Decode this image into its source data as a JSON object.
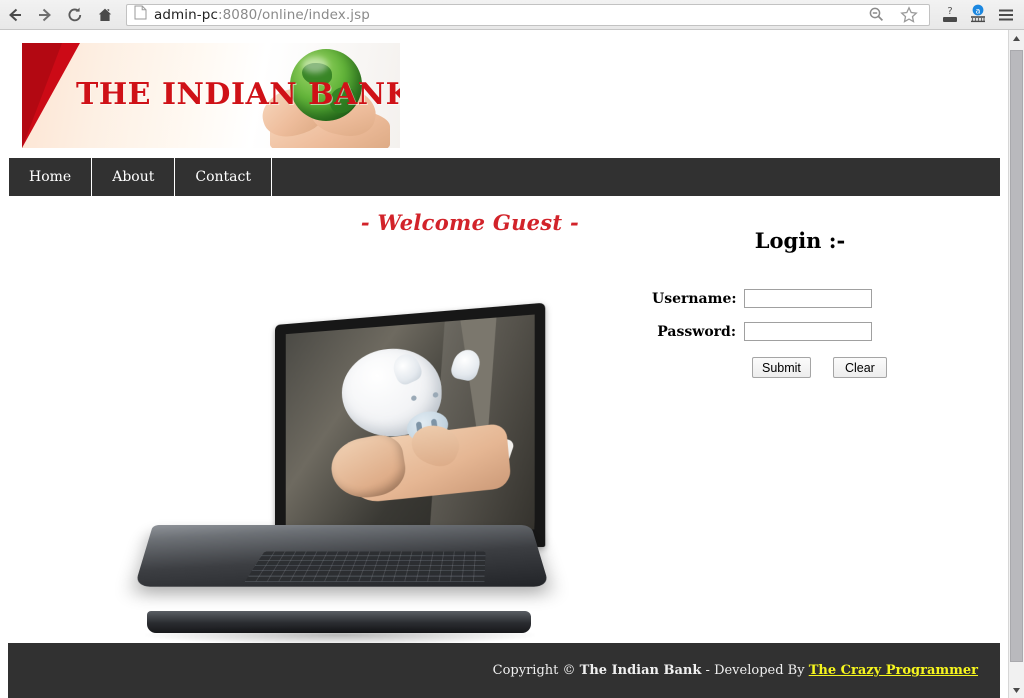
{
  "browser": {
    "back_label": "Back",
    "forward_label": "Forward",
    "reload_label": "Reload",
    "home_label": "Home",
    "url_host": "admin-pc",
    "url_rest": ":8080/online/index.jsp",
    "url_full": "admin-pc:8080/online/index.jsp",
    "icons": {
      "page": "page-icon",
      "back": "back-arrow-icon",
      "forward": "forward-arrow-icon",
      "reload": "reload-icon",
      "home": "home-icon",
      "zoom_out": "zoom-out-icon",
      "bookmark": "star-icon",
      "extension_help": "question-mark-extension-icon",
      "extension_adblock": "adblock-extension-icon",
      "menu": "hamburger-menu-icon"
    }
  },
  "banner": {
    "title": "THE INDIAN BANK",
    "art_name": "hands-holding-green-globe"
  },
  "nav": {
    "items": [
      {
        "label": "Home"
      },
      {
        "label": "About"
      },
      {
        "label": "Contact"
      }
    ]
  },
  "content": {
    "welcome": "- Welcome Guest -",
    "hero_alt": "laptop-with-hand-holding-piggy-bank"
  },
  "login": {
    "heading": "Login :-",
    "username_label": "Username:",
    "username_value": "",
    "username_placeholder": "",
    "password_label": "Password:",
    "password_value": "",
    "password_placeholder": "",
    "submit_label": "Submit",
    "clear_label": "Clear"
  },
  "footer": {
    "copyright_prefix": "Copyright © ",
    "bank_name": "The Indian Bank",
    "developed_by": " - Developed By ",
    "developer_link": "The Crazy Programmer"
  },
  "colors": {
    "brand_red": "#cf1117",
    "welcome_red": "#d2232a",
    "dark_bar": "#313131",
    "footer_link_yellow": "#f6f61e",
    "globe_green": "#63b53a"
  }
}
